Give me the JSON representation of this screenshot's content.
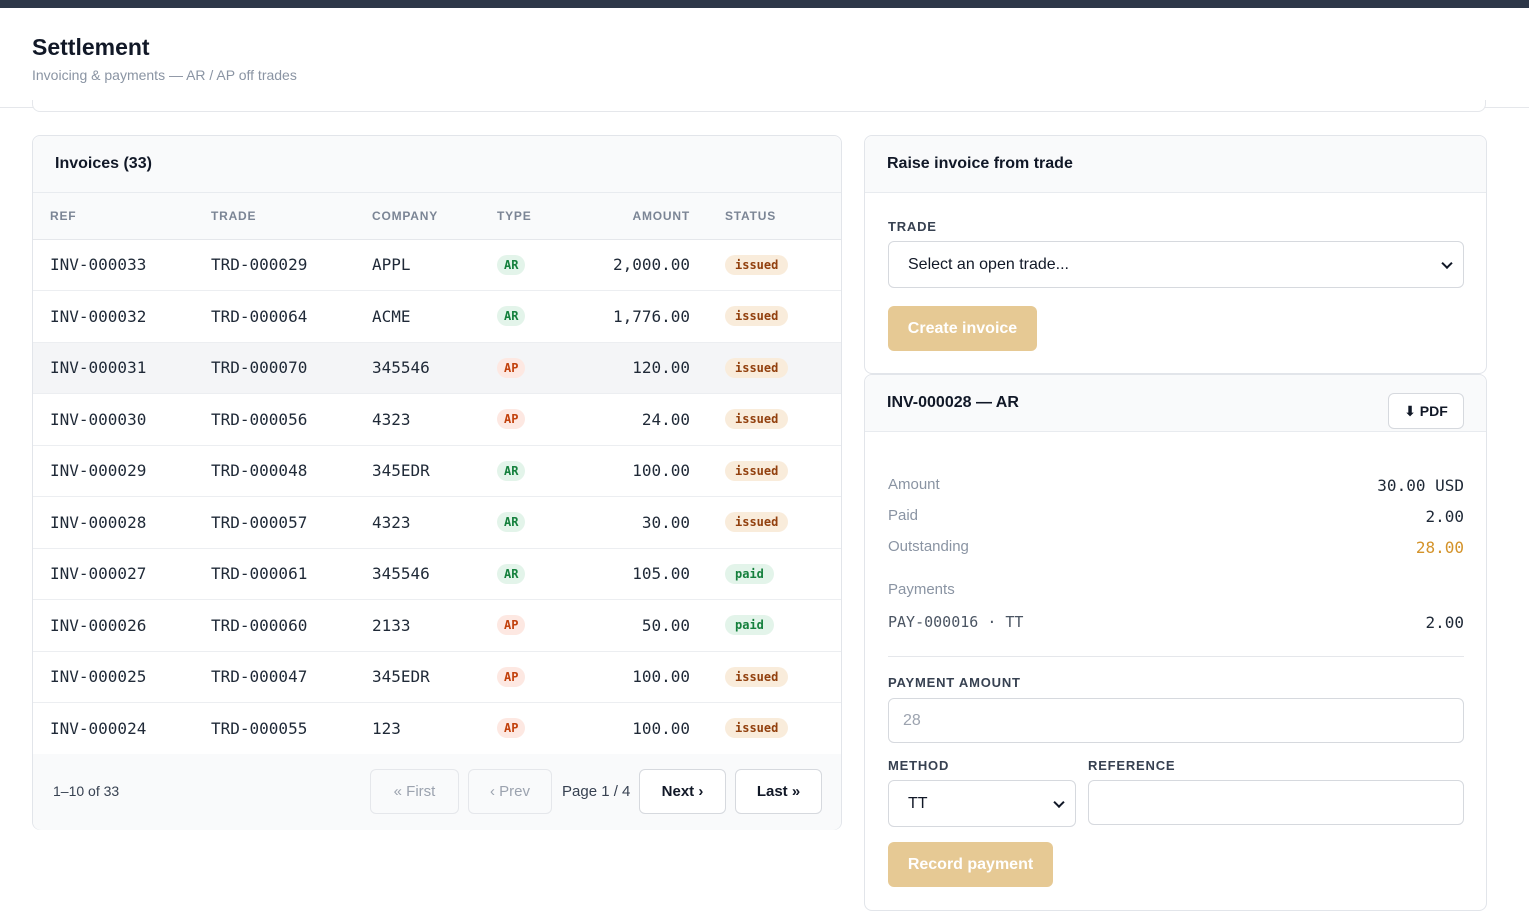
{
  "header": {
    "title": "Settlement",
    "subtitle": "Invoicing & payments — AR / AP off trades"
  },
  "invoices": {
    "title": "Invoices (33)",
    "columns": [
      "REF",
      "TRADE",
      "COMPANY",
      "TYPE",
      "AMOUNT",
      "STATUS"
    ],
    "rows": [
      {
        "ref": "INV-000033",
        "trade": "TRD-000029",
        "company": "APPL",
        "type": "AR",
        "amount": "2,000.00",
        "status": "issued"
      },
      {
        "ref": "INV-000032",
        "trade": "TRD-000064",
        "company": "ACME",
        "type": "AR",
        "amount": "1,776.00",
        "status": "issued"
      },
      {
        "ref": "INV-000031",
        "trade": "TRD-000070",
        "company": "345546",
        "type": "AP",
        "amount": "120.00",
        "status": "issued"
      },
      {
        "ref": "INV-000030",
        "trade": "TRD-000056",
        "company": "4323",
        "type": "AP",
        "amount": "24.00",
        "status": "issued"
      },
      {
        "ref": "INV-000029",
        "trade": "TRD-000048",
        "company": "345EDR",
        "type": "AR",
        "amount": "100.00",
        "status": "issued"
      },
      {
        "ref": "INV-000028",
        "trade": "TRD-000057",
        "company": "4323",
        "type": "AR",
        "amount": "30.00",
        "status": "issued"
      },
      {
        "ref": "INV-000027",
        "trade": "TRD-000061",
        "company": "345546",
        "type": "AR",
        "amount": "105.00",
        "status": "paid"
      },
      {
        "ref": "INV-000026",
        "trade": "TRD-000060",
        "company": "2133",
        "type": "AP",
        "amount": "50.00",
        "status": "paid"
      },
      {
        "ref": "INV-000025",
        "trade": "TRD-000047",
        "company": "345EDR",
        "type": "AP",
        "amount": "100.00",
        "status": "issued"
      },
      {
        "ref": "INV-000024",
        "trade": "TRD-000055",
        "company": "123",
        "type": "AP",
        "amount": "100.00",
        "status": "issued"
      }
    ],
    "pager": {
      "range": "1–10 of 33",
      "first": "« First",
      "prev": "‹ Prev",
      "page": "Page 1 / 4",
      "next": "Next ›",
      "last": "Last »"
    }
  },
  "raise": {
    "title": "Raise invoice from trade",
    "trade_label": "TRADE",
    "trade_placeholder": "Select an open trade...",
    "create_button": "Create invoice"
  },
  "detail": {
    "title": "INV-000028 — AR",
    "pdf_button": "⬇ PDF",
    "amount_label": "Amount",
    "amount_value": "30.00 USD",
    "paid_label": "Paid",
    "paid_value": "2.00",
    "outstanding_label": "Outstanding",
    "outstanding_value": "28.00",
    "payments_label": "Payments",
    "payments": [
      {
        "ref": "PAY-000016 · TT",
        "amount": "2.00"
      }
    ],
    "payment_amount_label": "PAYMENT AMOUNT",
    "payment_amount_placeholder": "28",
    "method_label": "METHOD",
    "method_value": "TT",
    "reference_label": "REFERENCE",
    "reference_value": "",
    "record_button": "Record payment"
  },
  "colors": {
    "outstanding": "#d4932a",
    "gold_button": "#e6c994",
    "ar_pill": "#15803d",
    "ap_pill": "#c2410c",
    "issued_pill": "#92400e"
  }
}
